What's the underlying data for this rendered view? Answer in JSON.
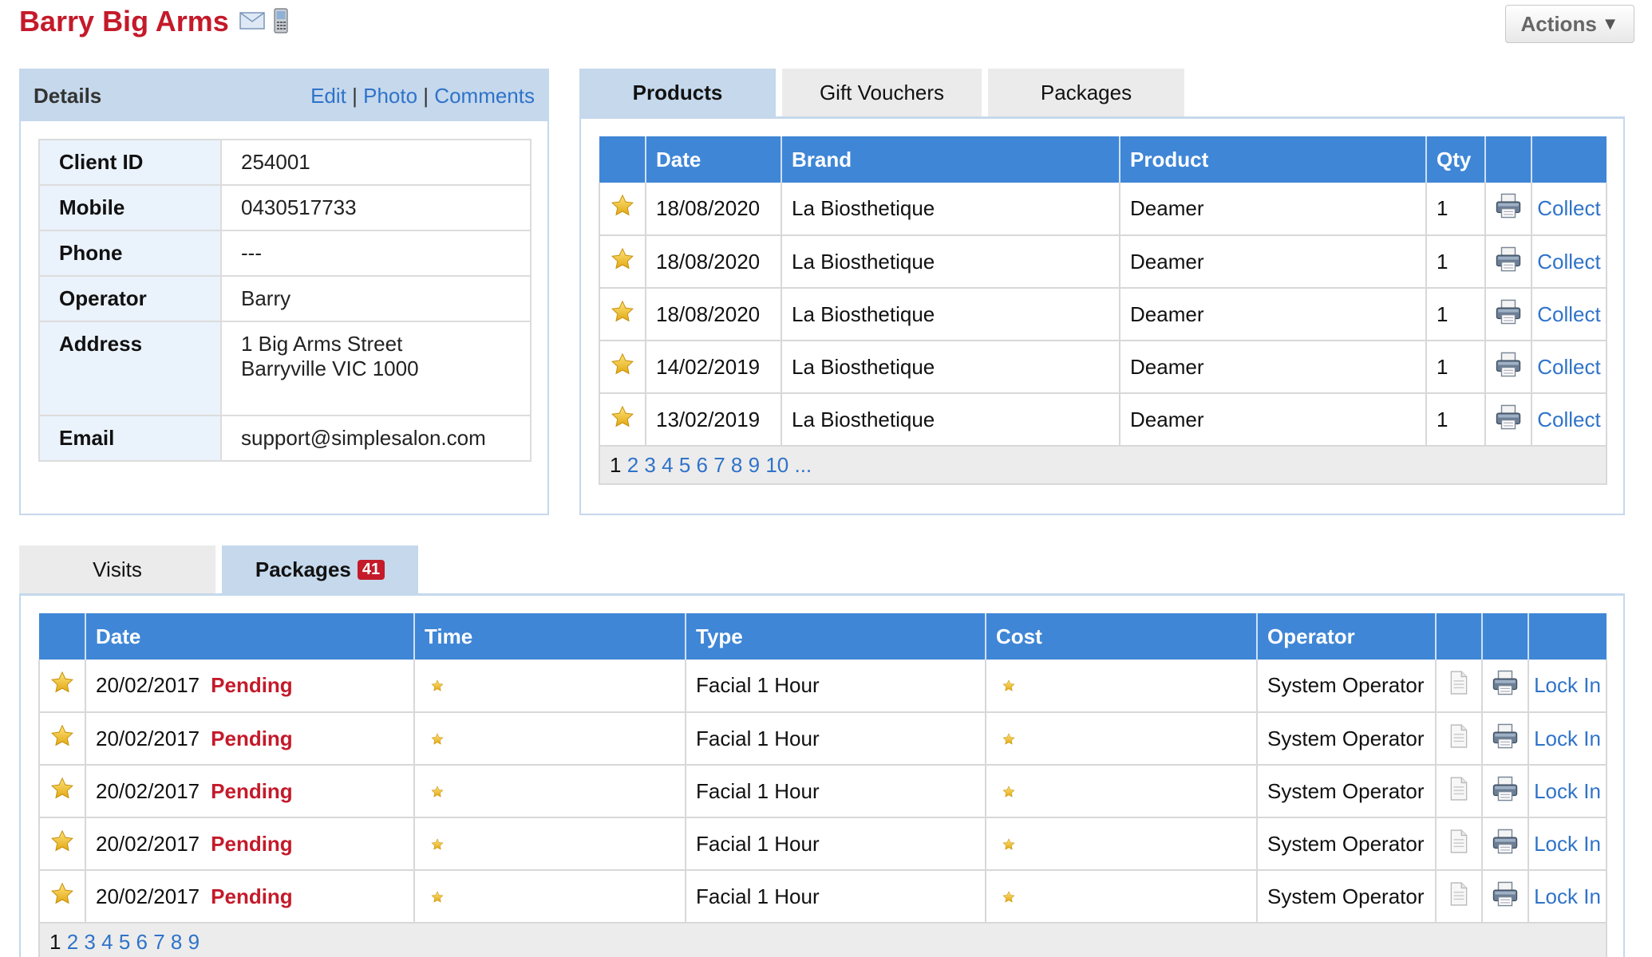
{
  "client": {
    "name": "Barry Big Arms",
    "actions_label": "Actions"
  },
  "details": {
    "title": "Details",
    "links": {
      "edit": "Edit",
      "photo": "Photo",
      "comments": "Comments",
      "sep": "|"
    },
    "rows": [
      {
        "label": "Client ID",
        "value": "254001"
      },
      {
        "label": "Mobile",
        "value": "0430517733"
      },
      {
        "label": "Phone",
        "value": "---"
      },
      {
        "label": "Operator",
        "value": "Barry"
      },
      {
        "label": "Address",
        "line1": "1 Big Arms Street",
        "line2": "Barryville VIC 1000"
      },
      {
        "label": "Email",
        "value": "support@simplesalon.com"
      }
    ]
  },
  "products_tabs": [
    "Products",
    "Gift Vouchers",
    "Packages"
  ],
  "products": {
    "columns": [
      "Date",
      "Brand",
      "Product",
      "Qty"
    ],
    "rows": [
      {
        "date": "18/08/2020",
        "brand": "La Biosthetique",
        "product": "Deamer",
        "qty": "1",
        "action": "Collect"
      },
      {
        "date": "18/08/2020",
        "brand": "La Biosthetique",
        "product": "Deamer",
        "qty": "1",
        "action": "Collect"
      },
      {
        "date": "18/08/2020",
        "brand": "La Biosthetique",
        "product": "Deamer",
        "qty": "1",
        "action": "Collect"
      },
      {
        "date": "14/02/2019",
        "brand": "La Biosthetique",
        "product": "Deamer",
        "qty": "1",
        "action": "Collect"
      },
      {
        "date": "13/02/2019",
        "brand": "La Biosthetique",
        "product": "Deamer",
        "qty": "1",
        "action": "Collect"
      }
    ],
    "pager": {
      "current": "1",
      "pages": [
        "2",
        "3",
        "4",
        "5",
        "6",
        "7",
        "8",
        "9",
        "10",
        "..."
      ]
    }
  },
  "packages_tabs": {
    "visits": "Visits",
    "packages": "Packages",
    "packages_count": "41"
  },
  "packages": {
    "columns": [
      "Date",
      "Time",
      "Type",
      "Cost",
      "Operator"
    ],
    "rows": [
      {
        "date": "20/02/2017",
        "status": "Pending",
        "type": "Facial 1 Hour",
        "operator": "System Operator",
        "action": "Lock In"
      },
      {
        "date": "20/02/2017",
        "status": "Pending",
        "type": "Facial 1 Hour",
        "operator": "System Operator",
        "action": "Lock In"
      },
      {
        "date": "20/02/2017",
        "status": "Pending",
        "type": "Facial 1 Hour",
        "operator": "System Operator",
        "action": "Lock In"
      },
      {
        "date": "20/02/2017",
        "status": "Pending",
        "type": "Facial 1 Hour",
        "operator": "System Operator",
        "action": "Lock In"
      },
      {
        "date": "20/02/2017",
        "status": "Pending",
        "type": "Facial 1 Hour",
        "operator": "System Operator",
        "action": "Lock In"
      }
    ],
    "pager": {
      "current": "1",
      "pages": [
        "2",
        "3",
        "4",
        "5",
        "6",
        "7",
        "8",
        "9"
      ]
    }
  },
  "colors": {
    "brand_red": "#c41a2a",
    "header_blue": "#3f86d6",
    "panel_blue": "#c5d8ec",
    "link_blue": "#2f73c9"
  },
  "icons": [
    "envelope-icon",
    "mobile-phone-icon",
    "star-icon",
    "printer-icon",
    "document-icon"
  ]
}
